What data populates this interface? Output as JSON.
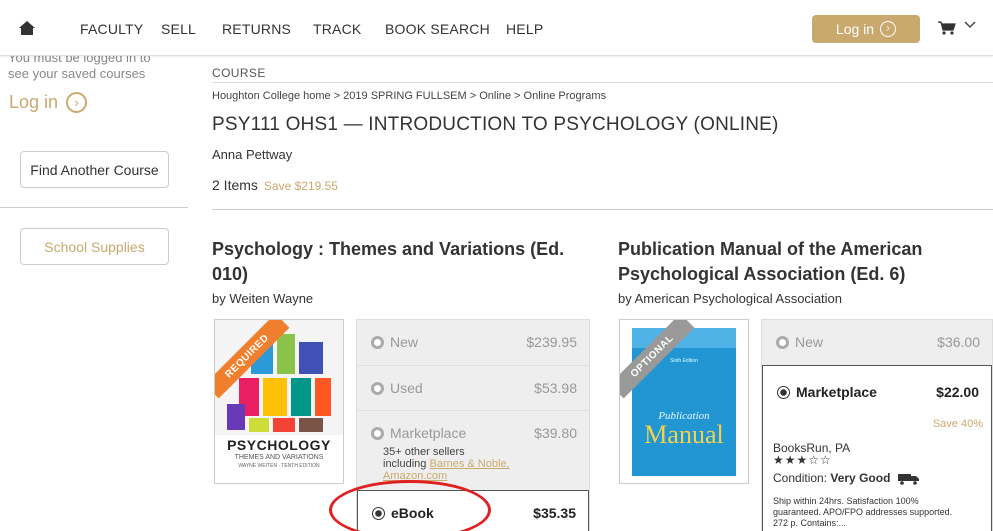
{
  "nav": {
    "links": [
      "FACULTY",
      "SELL",
      "RETURNS",
      "TRACK",
      "BOOK SEARCH",
      "HELP"
    ],
    "login_label": "Log in"
  },
  "sidebar": {
    "faded_line1": "You must be logged in to",
    "faded_line2": "see your saved courses",
    "login_label": "Log in",
    "find_course_label": "Find Another Course",
    "school_supplies_label": "School Supplies"
  },
  "course": {
    "section_label": "COURSE",
    "breadcrumb": "Houghton College home > 2019 SPRING FULLSEM > Online > Online Programs",
    "title": "PSY111 OHS1 — INTRODUCTION TO PSYCHOLOGY (ONLINE)",
    "instructor": "Anna Pettway",
    "items_count": "2 Items",
    "save_text": "Save $219.55"
  },
  "books": [
    {
      "title_line1": "Psychology : Themes and Variations (Ed.",
      "title_line2": "010)",
      "author": "by Weiten Wayne",
      "ribbon": "REQUIRED",
      "cover": {
        "title": "PSYCHOLOGY",
        "subtitle": "THEMES AND VARIATIONS",
        "author": "WAYNE WEITEN · TENTH EDITION"
      },
      "options": [
        {
          "name": "New",
          "price": "$239.95"
        },
        {
          "name": "Used",
          "price": "$53.98"
        },
        {
          "name": "Marketplace",
          "price": "$39.80",
          "note1": "35+ other sellers",
          "note2": "including ",
          "link1": "Barnes & Noble,",
          "link2": "Amazon.com"
        },
        {
          "name": "eBook",
          "price": "$35.35"
        }
      ]
    },
    {
      "title_line1": "Publication Manual of the American",
      "title_line2": "Psychological Association (Ed. 6)",
      "author": "by American Psychological Association",
      "ribbon": "OPTIONAL",
      "cover": {
        "title_small": "Publication",
        "title_big": "Manual",
        "edition": "Sixth Edition"
      },
      "options": [
        {
          "name": "New",
          "price": "$36.00"
        },
        {
          "name": "Marketplace",
          "price": "$22.00",
          "save": "Save 40%",
          "seller": "BooksRun, PA",
          "stars": "★★★☆☆",
          "condition_label": "Condition: ",
          "condition_value": "Very Good",
          "desc1": "Ship within 24hrs. Satisfaction 100%",
          "desc2": "guaranteed. APO/FPO addresses supported.",
          "desc3": "272 p. Contains:..."
        }
      ]
    }
  ],
  "colors": {
    "accent": "#c9a96e",
    "required": "#f07f2d",
    "annotation": "#e02020"
  }
}
